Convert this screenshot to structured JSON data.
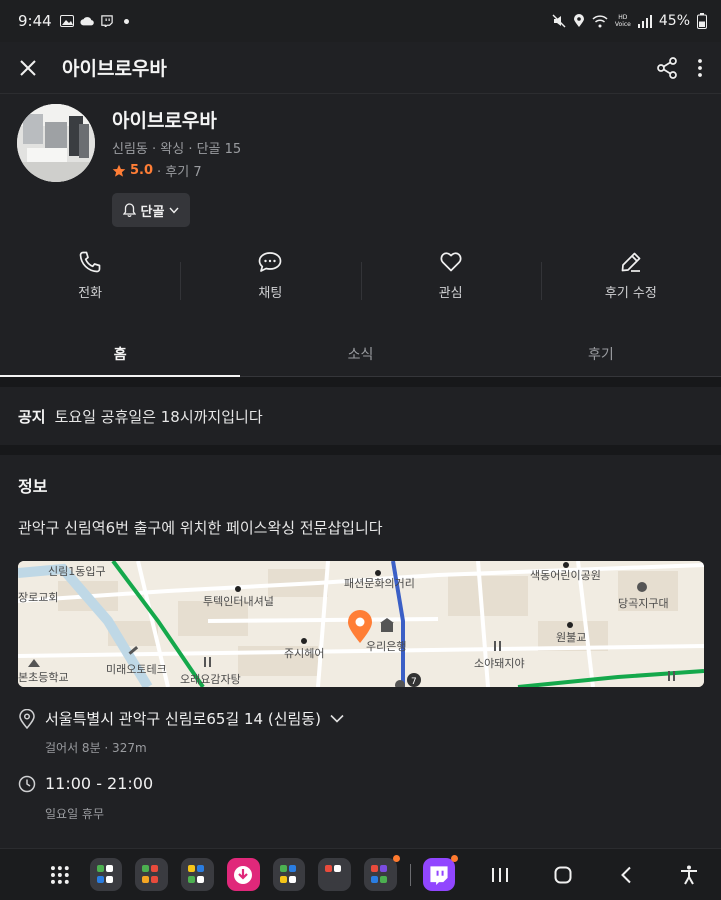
{
  "status_bar": {
    "time": "9:44",
    "battery": "45%",
    "volte": "HD Voice"
  },
  "app_bar": {
    "title": "아이브로우바"
  },
  "profile": {
    "name": "아이브로우바",
    "meta": "신림동 · 왁싱 · 단골 15",
    "rating": "5.0",
    "reviews": "· 후기 7",
    "follow_label": "단골"
  },
  "actions": [
    {
      "label": "전화",
      "icon": "phone-icon"
    },
    {
      "label": "채팅",
      "icon": "chat-icon"
    },
    {
      "label": "관심",
      "icon": "heart-icon"
    },
    {
      "label": "후기 수정",
      "icon": "pencil-icon"
    }
  ],
  "tabs": [
    {
      "label": "홈",
      "active": true
    },
    {
      "label": "소식",
      "active": false
    },
    {
      "label": "후기",
      "active": false
    }
  ],
  "notice": {
    "label": "공지",
    "text": "토요일 공휴일은 18시까지입니다"
  },
  "info": {
    "title": "정보",
    "description": "관악구 신림역6번 출구에 위치한 페이스왁싱 전문샵입니다"
  },
  "map": {
    "labels": [
      "신림1동입구",
      "장로교회",
      "투텍인터내셔널",
      "패션문화의거리",
      "색동어린이공원",
      "당곡지구대",
      "쥬시헤어",
      "우리은행",
      "원불교",
      "소야돼지야",
      "미래오토테크",
      "오래요감자탕",
      "본초등학교"
    ],
    "marker_color": "#ff7e36",
    "station_number": "7"
  },
  "address": {
    "text": "서울특별시 관악구 신림로65길 14 (신림동)",
    "sub": "걸어서 8분 · 327m"
  },
  "hours": {
    "text": "11:00 - 21:00",
    "sub": "일요일 휴무"
  },
  "colors": {
    "accent": "#ff7e36",
    "background": "#202124"
  }
}
